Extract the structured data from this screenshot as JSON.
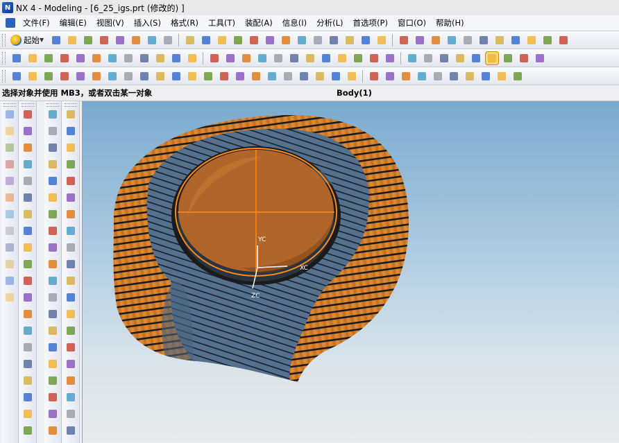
{
  "window": {
    "title": "NX 4 - Modeling - [6_25_igs.prt (修改的) ]",
    "app_icon": "nx-logo-icon"
  },
  "menu": {
    "items": [
      {
        "label": "文件(F)"
      },
      {
        "label": "编辑(E)"
      },
      {
        "label": "视图(V)"
      },
      {
        "label": "插入(S)"
      },
      {
        "label": "格式(R)"
      },
      {
        "label": "工具(T)"
      },
      {
        "label": "装配(A)"
      },
      {
        "label": "信息(I)"
      },
      {
        "label": "分析(L)"
      },
      {
        "label": "首选项(P)"
      },
      {
        "label": "窗口(O)"
      },
      {
        "label": "帮助(H)"
      }
    ]
  },
  "toolbar": {
    "start_label": "起始",
    "colors": [
      "#3b6fd0",
      "#f1b43a",
      "#6a9a3a",
      "#c94a3a",
      "#8a5bc0",
      "#e07b1f",
      "#4fa0c8",
      "#9aa0aa",
      "#5a6f9e",
      "#d6b04a"
    ]
  },
  "status": {
    "prompt": "选择对象并使用 MB3，或者双击某一对象",
    "selection": "Body(1)"
  },
  "viewport": {
    "axis_labels": {
      "yc": "YC",
      "xc": "XC",
      "zc": "ZC"
    },
    "colors": {
      "orange": "#d9822b",
      "blue_gray": "#4f6a85",
      "stripe": "#1a1a1a",
      "highlight": "#ff8a1c"
    }
  }
}
